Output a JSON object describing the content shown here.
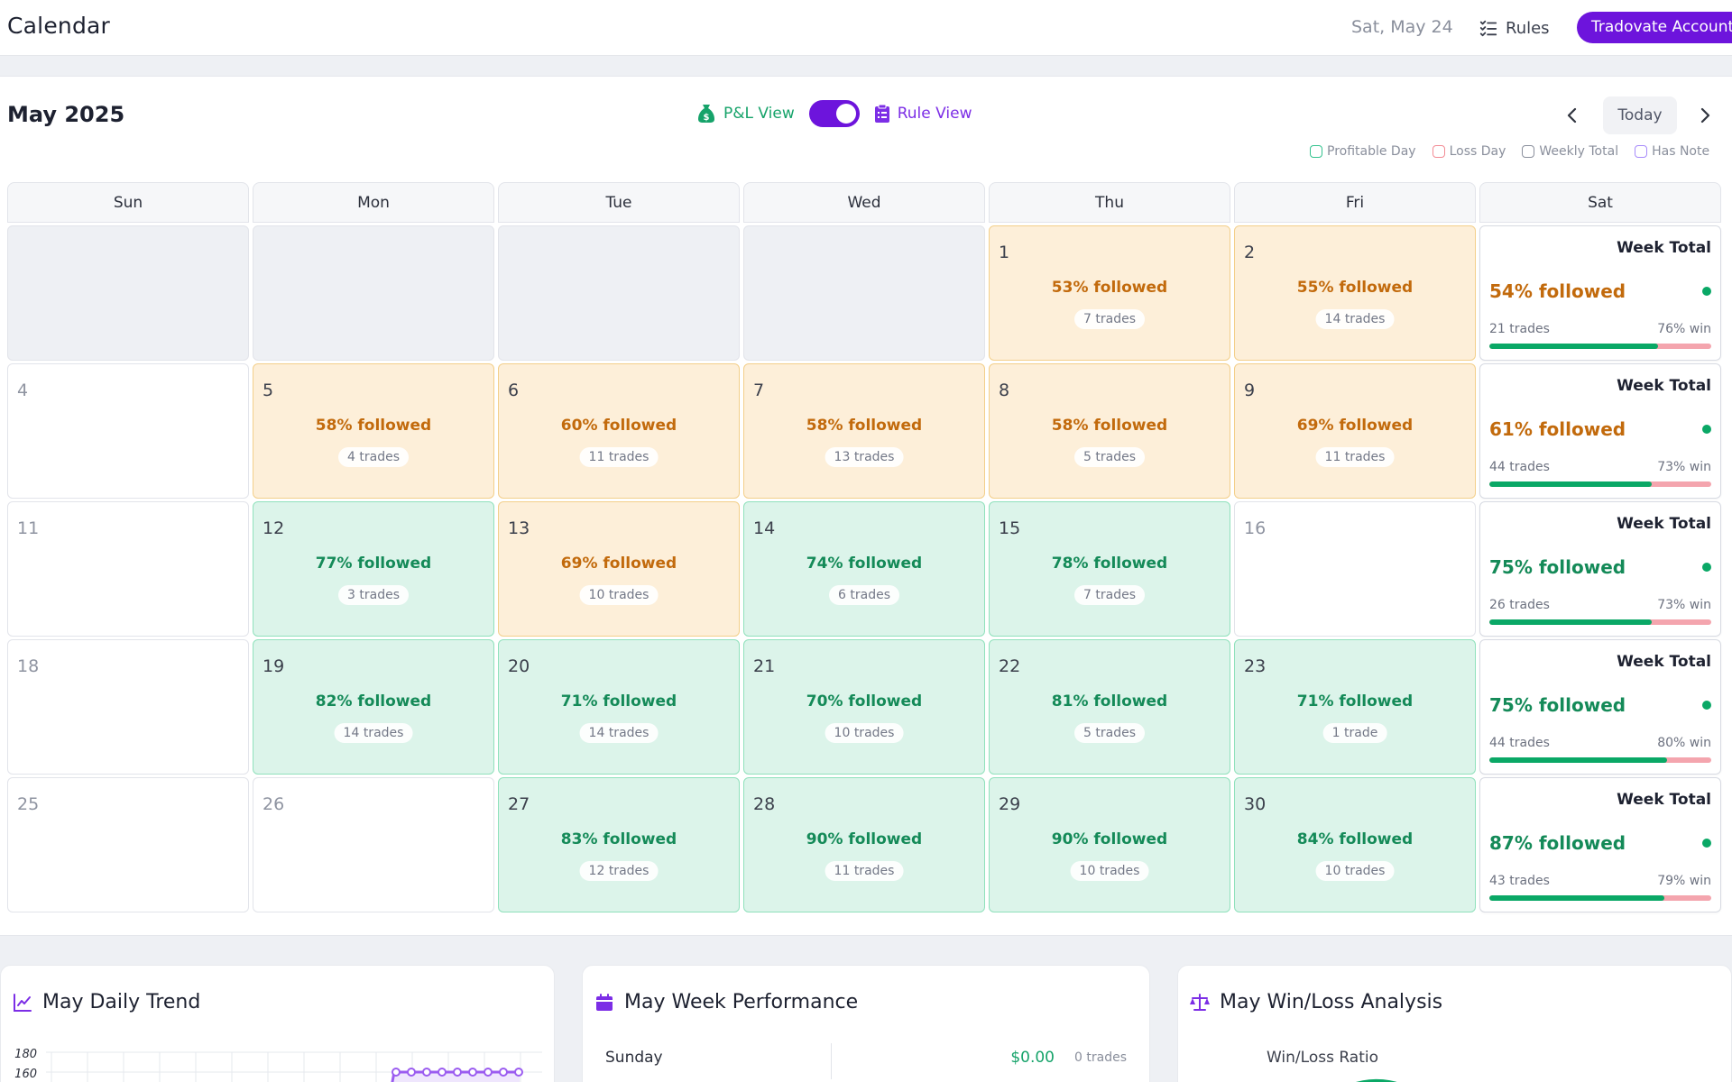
{
  "header": {
    "title": "Calendar",
    "date": "Sat, May 24",
    "rules_label": "Rules",
    "account_label": "Tradovate Account"
  },
  "calendar": {
    "month_title": "May 2025",
    "pl_view_label": "P&L View",
    "rule_view_label": "Rule View",
    "today_label": "Today",
    "legend": [
      {
        "label": "Profitable Day",
        "color": "#34c38f"
      },
      {
        "label": "Loss Day",
        "color": "#f28b94"
      },
      {
        "label": "Weekly Total",
        "color": "#8a8f9c"
      },
      {
        "label": "Has Note",
        "color": "#a78bfa"
      }
    ],
    "days_of_week": [
      "Sun",
      "Mon",
      "Tue",
      "Wed",
      "Thu",
      "Fri",
      "Sat"
    ],
    "weeks": [
      {
        "days": [
          {
            "type": "empty"
          },
          {
            "type": "empty"
          },
          {
            "type": "empty"
          },
          {
            "type": "empty"
          },
          {
            "type": "warn",
            "day": "1",
            "followed": "53% followed",
            "trades": "7 trades"
          },
          {
            "type": "warn",
            "day": "2",
            "followed": "55% followed",
            "trades": "14 trades"
          }
        ],
        "total": {
          "title": "Week Total",
          "followed": "54% followed",
          "trades": "21 trades",
          "win": "76% win",
          "win_rate": 0.76,
          "color": "#c26a0c"
        }
      },
      {
        "days": [
          {
            "type": "plain",
            "day": "4"
          },
          {
            "type": "warn",
            "day": "5",
            "followed": "58% followed",
            "trades": "4 trades"
          },
          {
            "type": "warn",
            "day": "6",
            "followed": "60% followed",
            "trades": "11 trades"
          },
          {
            "type": "warn",
            "day": "7",
            "followed": "58% followed",
            "trades": "13 trades"
          },
          {
            "type": "warn",
            "day": "8",
            "followed": "58% followed",
            "trades": "5 trades"
          },
          {
            "type": "warn",
            "day": "9",
            "followed": "69% followed",
            "trades": "11 trades"
          }
        ],
        "total": {
          "title": "Week Total",
          "followed": "61% followed",
          "trades": "44 trades",
          "win": "73% win",
          "win_rate": 0.73,
          "color": "#c26a0c"
        }
      },
      {
        "days": [
          {
            "type": "plain",
            "day": "11"
          },
          {
            "type": "good",
            "day": "12",
            "followed": "77% followed",
            "trades": "3 trades"
          },
          {
            "type": "warn",
            "day": "13",
            "followed": "69% followed",
            "trades": "10 trades"
          },
          {
            "type": "good",
            "day": "14",
            "followed": "74% followed",
            "trades": "6 trades"
          },
          {
            "type": "good",
            "day": "15",
            "followed": "78% followed",
            "trades": "7 trades"
          },
          {
            "type": "plain",
            "day": "16"
          }
        ],
        "total": {
          "title": "Week Total",
          "followed": "75% followed",
          "trades": "26 trades",
          "win": "73% win",
          "win_rate": 0.73,
          "color": "#148a58"
        }
      },
      {
        "days": [
          {
            "type": "plain",
            "day": "18"
          },
          {
            "type": "good",
            "day": "19",
            "followed": "82% followed",
            "trades": "14 trades"
          },
          {
            "type": "good",
            "day": "20",
            "followed": "71% followed",
            "trades": "14 trades"
          },
          {
            "type": "good",
            "day": "21",
            "followed": "70% followed",
            "trades": "10 trades"
          },
          {
            "type": "good",
            "day": "22",
            "followed": "81% followed",
            "trades": "5 trades"
          },
          {
            "type": "good",
            "day": "23",
            "followed": "71% followed",
            "trades": "1 trade"
          }
        ],
        "total": {
          "title": "Week Total",
          "followed": "75% followed",
          "trades": "44 trades",
          "win": "80% win",
          "win_rate": 0.8,
          "color": "#148a58"
        }
      },
      {
        "days": [
          {
            "type": "plain",
            "day": "25"
          },
          {
            "type": "plain",
            "day": "26"
          },
          {
            "type": "good",
            "day": "27",
            "followed": "83% followed",
            "trades": "12 trades"
          },
          {
            "type": "good",
            "day": "28",
            "followed": "90% followed",
            "trades": "11 trades"
          },
          {
            "type": "good",
            "day": "29",
            "followed": "90% followed",
            "trades": "10 trades"
          },
          {
            "type": "good",
            "day": "30",
            "followed": "84% followed",
            "trades": "10 trades"
          }
        ],
        "total": {
          "title": "Week Total",
          "followed": "87% followed",
          "trades": "43 trades",
          "win": "79% win",
          "win_rate": 0.79,
          "color": "#148a58"
        }
      }
    ]
  },
  "cards": {
    "daily_trend": {
      "title": "May Daily Trend",
      "y_ticks": [
        "180",
        "160"
      ]
    },
    "week_performance": {
      "title": "May Week Performance",
      "rows": [
        {
          "day": "Sunday",
          "value": "$0.00",
          "trades": "0 trades"
        }
      ]
    },
    "win_loss": {
      "title": "May Win/Loss Analysis",
      "subtitle": "Win/Loss Ratio"
    }
  },
  "colors": {
    "accent": "#6d14dc",
    "profit": "#0aa866",
    "warning": "#c26a0c"
  }
}
